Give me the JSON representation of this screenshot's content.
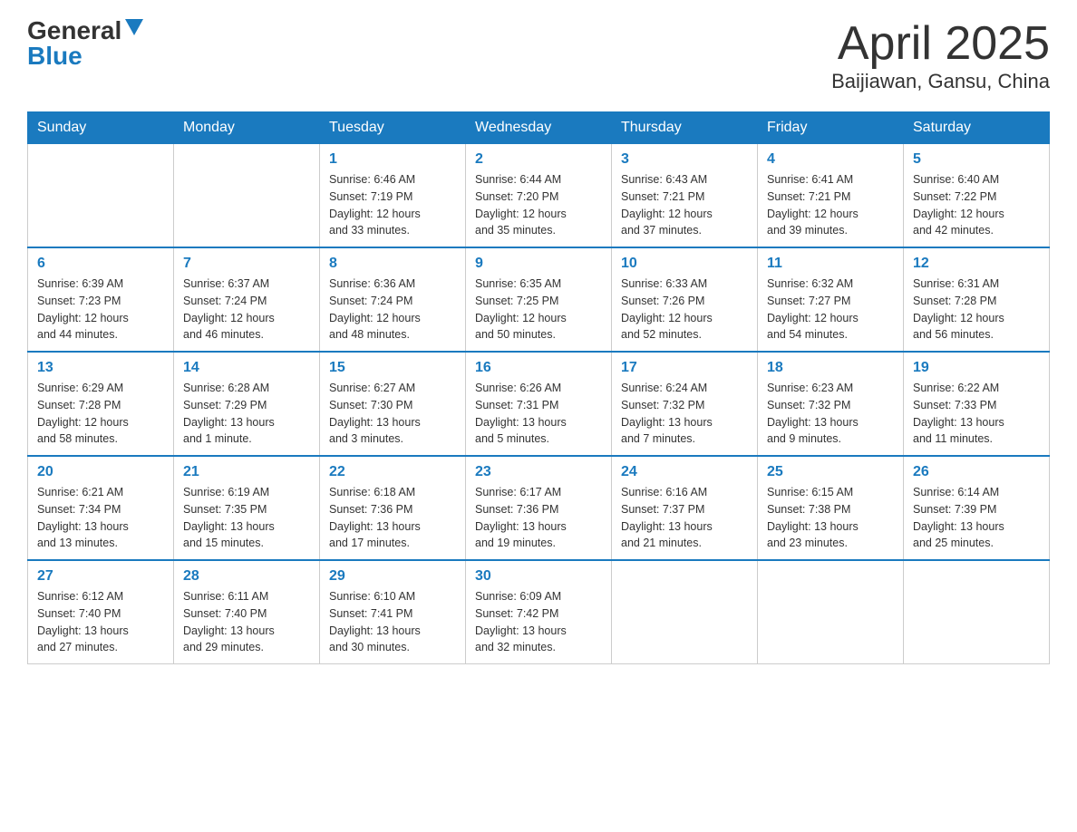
{
  "header": {
    "logo_general": "General",
    "logo_blue": "Blue",
    "title": "April 2025",
    "subtitle": "Baijiawan, Gansu, China"
  },
  "calendar": {
    "days_of_week": [
      "Sunday",
      "Monday",
      "Tuesday",
      "Wednesday",
      "Thursday",
      "Friday",
      "Saturday"
    ],
    "weeks": [
      [
        {
          "day": "",
          "info": ""
        },
        {
          "day": "",
          "info": ""
        },
        {
          "day": "1",
          "info": "Sunrise: 6:46 AM\nSunset: 7:19 PM\nDaylight: 12 hours\nand 33 minutes."
        },
        {
          "day": "2",
          "info": "Sunrise: 6:44 AM\nSunset: 7:20 PM\nDaylight: 12 hours\nand 35 minutes."
        },
        {
          "day": "3",
          "info": "Sunrise: 6:43 AM\nSunset: 7:21 PM\nDaylight: 12 hours\nand 37 minutes."
        },
        {
          "day": "4",
          "info": "Sunrise: 6:41 AM\nSunset: 7:21 PM\nDaylight: 12 hours\nand 39 minutes."
        },
        {
          "day": "5",
          "info": "Sunrise: 6:40 AM\nSunset: 7:22 PM\nDaylight: 12 hours\nand 42 minutes."
        }
      ],
      [
        {
          "day": "6",
          "info": "Sunrise: 6:39 AM\nSunset: 7:23 PM\nDaylight: 12 hours\nand 44 minutes."
        },
        {
          "day": "7",
          "info": "Sunrise: 6:37 AM\nSunset: 7:24 PM\nDaylight: 12 hours\nand 46 minutes."
        },
        {
          "day": "8",
          "info": "Sunrise: 6:36 AM\nSunset: 7:24 PM\nDaylight: 12 hours\nand 48 minutes."
        },
        {
          "day": "9",
          "info": "Sunrise: 6:35 AM\nSunset: 7:25 PM\nDaylight: 12 hours\nand 50 minutes."
        },
        {
          "day": "10",
          "info": "Sunrise: 6:33 AM\nSunset: 7:26 PM\nDaylight: 12 hours\nand 52 minutes."
        },
        {
          "day": "11",
          "info": "Sunrise: 6:32 AM\nSunset: 7:27 PM\nDaylight: 12 hours\nand 54 minutes."
        },
        {
          "day": "12",
          "info": "Sunrise: 6:31 AM\nSunset: 7:28 PM\nDaylight: 12 hours\nand 56 minutes."
        }
      ],
      [
        {
          "day": "13",
          "info": "Sunrise: 6:29 AM\nSunset: 7:28 PM\nDaylight: 12 hours\nand 58 minutes."
        },
        {
          "day": "14",
          "info": "Sunrise: 6:28 AM\nSunset: 7:29 PM\nDaylight: 13 hours\nand 1 minute."
        },
        {
          "day": "15",
          "info": "Sunrise: 6:27 AM\nSunset: 7:30 PM\nDaylight: 13 hours\nand 3 minutes."
        },
        {
          "day": "16",
          "info": "Sunrise: 6:26 AM\nSunset: 7:31 PM\nDaylight: 13 hours\nand 5 minutes."
        },
        {
          "day": "17",
          "info": "Sunrise: 6:24 AM\nSunset: 7:32 PM\nDaylight: 13 hours\nand 7 minutes."
        },
        {
          "day": "18",
          "info": "Sunrise: 6:23 AM\nSunset: 7:32 PM\nDaylight: 13 hours\nand 9 minutes."
        },
        {
          "day": "19",
          "info": "Sunrise: 6:22 AM\nSunset: 7:33 PM\nDaylight: 13 hours\nand 11 minutes."
        }
      ],
      [
        {
          "day": "20",
          "info": "Sunrise: 6:21 AM\nSunset: 7:34 PM\nDaylight: 13 hours\nand 13 minutes."
        },
        {
          "day": "21",
          "info": "Sunrise: 6:19 AM\nSunset: 7:35 PM\nDaylight: 13 hours\nand 15 minutes."
        },
        {
          "day": "22",
          "info": "Sunrise: 6:18 AM\nSunset: 7:36 PM\nDaylight: 13 hours\nand 17 minutes."
        },
        {
          "day": "23",
          "info": "Sunrise: 6:17 AM\nSunset: 7:36 PM\nDaylight: 13 hours\nand 19 minutes."
        },
        {
          "day": "24",
          "info": "Sunrise: 6:16 AM\nSunset: 7:37 PM\nDaylight: 13 hours\nand 21 minutes."
        },
        {
          "day": "25",
          "info": "Sunrise: 6:15 AM\nSunset: 7:38 PM\nDaylight: 13 hours\nand 23 minutes."
        },
        {
          "day": "26",
          "info": "Sunrise: 6:14 AM\nSunset: 7:39 PM\nDaylight: 13 hours\nand 25 minutes."
        }
      ],
      [
        {
          "day": "27",
          "info": "Sunrise: 6:12 AM\nSunset: 7:40 PM\nDaylight: 13 hours\nand 27 minutes."
        },
        {
          "day": "28",
          "info": "Sunrise: 6:11 AM\nSunset: 7:40 PM\nDaylight: 13 hours\nand 29 minutes."
        },
        {
          "day": "29",
          "info": "Sunrise: 6:10 AM\nSunset: 7:41 PM\nDaylight: 13 hours\nand 30 minutes."
        },
        {
          "day": "30",
          "info": "Sunrise: 6:09 AM\nSunset: 7:42 PM\nDaylight: 13 hours\nand 32 minutes."
        },
        {
          "day": "",
          "info": ""
        },
        {
          "day": "",
          "info": ""
        },
        {
          "day": "",
          "info": ""
        }
      ]
    ]
  }
}
